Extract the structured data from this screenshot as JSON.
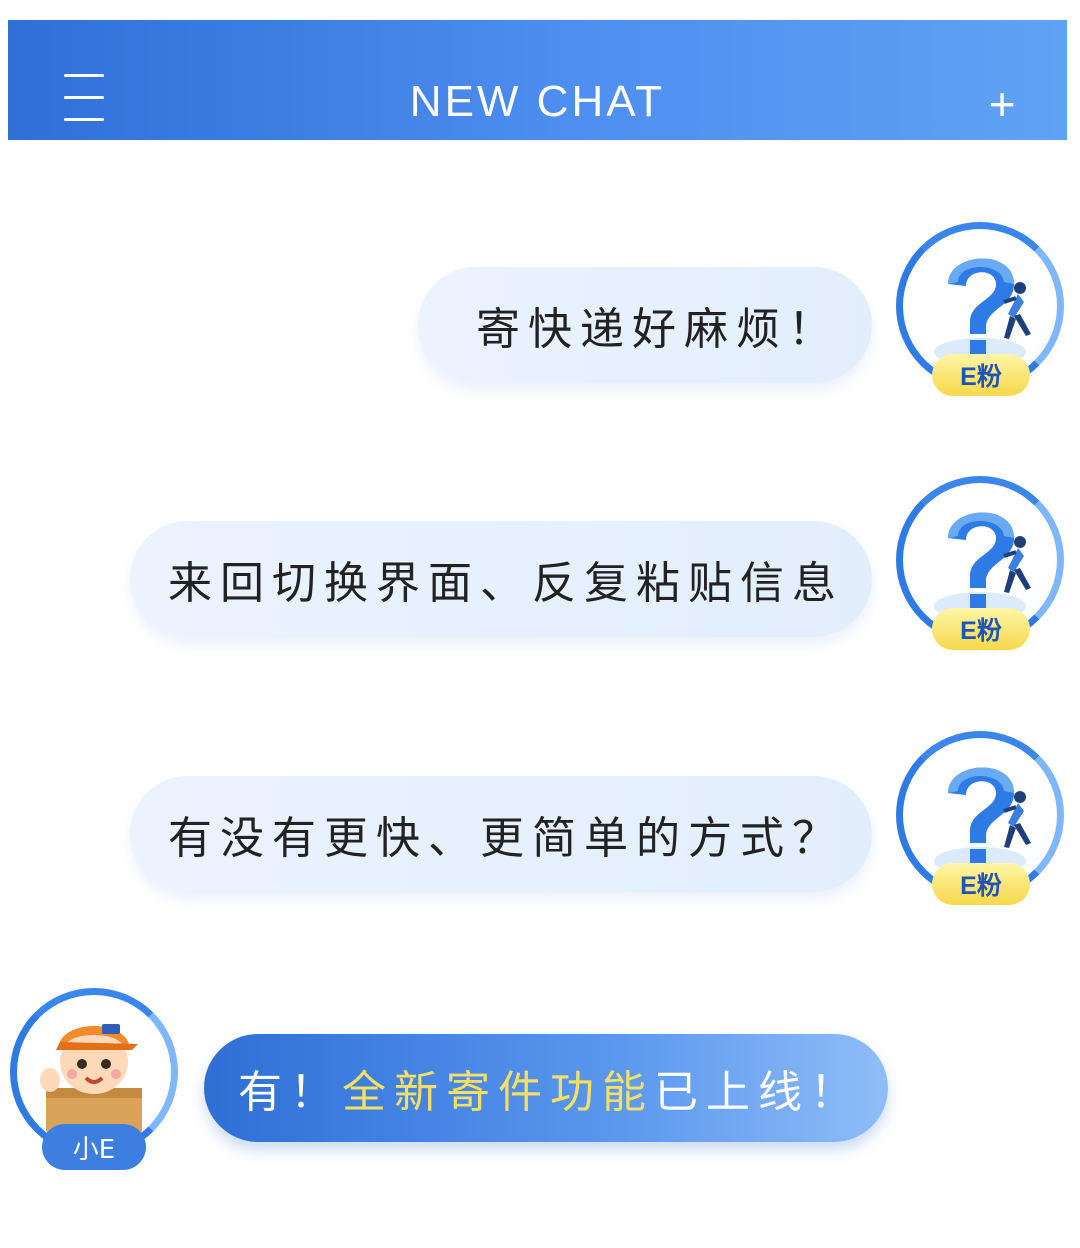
{
  "header": {
    "title": "NEW CHAT",
    "menu_icon": "hamburger-menu-icon",
    "add_icon": "plus-icon",
    "add_label": "+"
  },
  "colors": {
    "header_gradient_start": "#2f6fd8",
    "header_gradient_end": "#5ea2f4",
    "user_bubble": "#e6f0fd",
    "bot_bubble": "#3a7de0",
    "highlight_text": "#f7df62",
    "badge_yellow": "#f6d84a"
  },
  "messages": [
    {
      "sender": "user",
      "text": "寄快递好麻烦！",
      "badge": "E粉"
    },
    {
      "sender": "user",
      "text": "来回切换界面、反复粘贴信息",
      "badge": "E粉"
    },
    {
      "sender": "user",
      "text": "有没有更快、更简单的方式？",
      "badge": "E粉"
    },
    {
      "sender": "bot",
      "text_prefix": "有！",
      "text_highlight": "全新寄件功能",
      "text_suffix": "已上线！",
      "badge": "小E"
    }
  ]
}
